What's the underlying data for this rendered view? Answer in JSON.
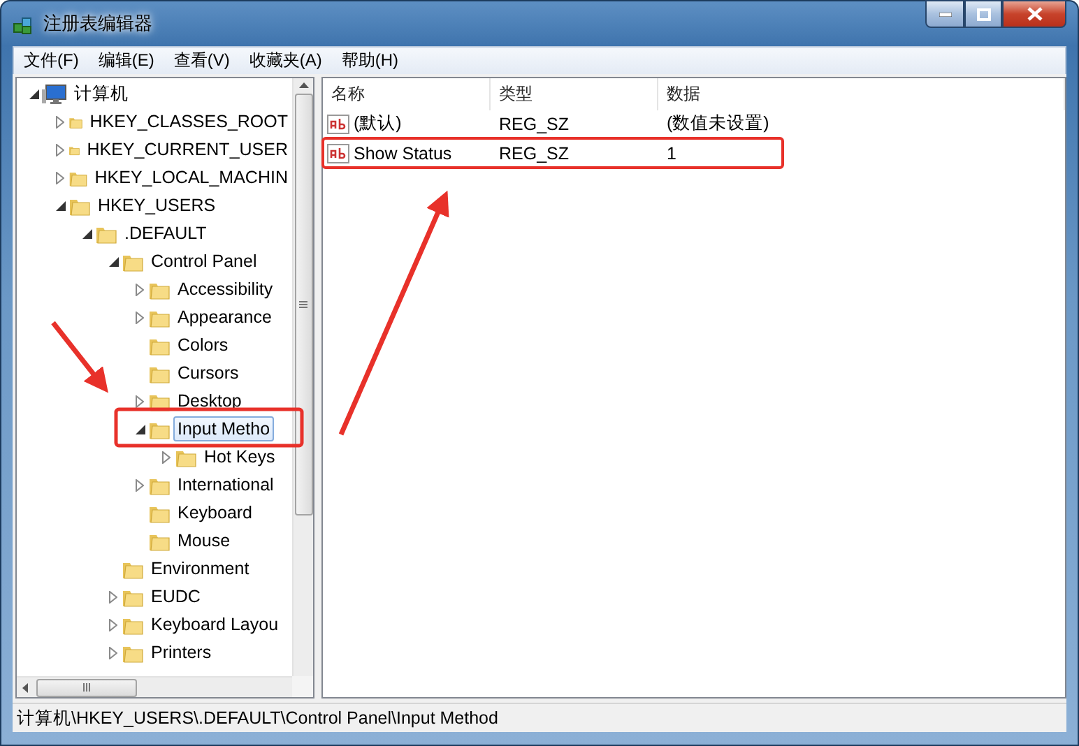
{
  "window": {
    "title": "注册表编辑器"
  },
  "menu": [
    "文件(F)",
    "编辑(E)",
    "查看(V)",
    "收藏夹(A)",
    "帮助(H)"
  ],
  "tree": [
    {
      "label": "计算机",
      "kind": "computer",
      "expandable": true,
      "expanded": true,
      "selected": false,
      "children": [
        {
          "label": "HKEY_CLASSES_ROOT",
          "kind": "folder",
          "expandable": true,
          "expanded": false,
          "selected": false
        },
        {
          "label": "HKEY_CURRENT_USER",
          "kind": "folder",
          "expandable": true,
          "expanded": false,
          "selected": false
        },
        {
          "label": "HKEY_LOCAL_MACHIN",
          "kind": "folder",
          "expandable": true,
          "expanded": false,
          "selected": false
        },
        {
          "label": "HKEY_USERS",
          "kind": "folder",
          "expandable": true,
          "expanded": true,
          "selected": false,
          "children": [
            {
              "label": ".DEFAULT",
              "kind": "folder",
              "expandable": true,
              "expanded": true,
              "selected": false,
              "children": [
                {
                  "label": "Control Panel",
                  "kind": "folder",
                  "expandable": true,
                  "expanded": true,
                  "selected": false,
                  "children": [
                    {
                      "label": "Accessibility",
                      "kind": "folder",
                      "expandable": true,
                      "expanded": false,
                      "selected": false
                    },
                    {
                      "label": "Appearance",
                      "kind": "folder",
                      "expandable": true,
                      "expanded": false,
                      "selected": false
                    },
                    {
                      "label": "Colors",
                      "kind": "folder",
                      "expandable": false,
                      "selected": false
                    },
                    {
                      "label": "Cursors",
                      "kind": "folder",
                      "expandable": false,
                      "selected": false
                    },
                    {
                      "label": "Desktop",
                      "kind": "folder",
                      "expandable": true,
                      "expanded": false,
                      "selected": false
                    },
                    {
                      "label": "Input Metho",
                      "kind": "folder",
                      "expandable": true,
                      "expanded": true,
                      "selected": true,
                      "children": [
                        {
                          "label": "Hot Keys",
                          "kind": "folder",
                          "expandable": true,
                          "expanded": false,
                          "selected": false
                        }
                      ]
                    },
                    {
                      "label": "International",
                      "kind": "folder",
                      "expandable": true,
                      "expanded": false,
                      "selected": false
                    },
                    {
                      "label": "Keyboard",
                      "kind": "folder",
                      "expandable": false,
                      "selected": false
                    },
                    {
                      "label": "Mouse",
                      "kind": "folder",
                      "expandable": false,
                      "selected": false
                    }
                  ]
                },
                {
                  "label": "Environment",
                  "kind": "folder",
                  "expandable": false,
                  "selected": false
                },
                {
                  "label": "EUDC",
                  "kind": "folder",
                  "expandable": true,
                  "expanded": false,
                  "selected": false
                },
                {
                  "label": "Keyboard Layou",
                  "kind": "folder",
                  "expandable": true,
                  "expanded": false,
                  "selected": false
                },
                {
                  "label": "Printers",
                  "kind": "folder",
                  "expandable": true,
                  "expanded": false,
                  "selected": false
                }
              ]
            }
          ]
        }
      ]
    }
  ],
  "table": {
    "columns": [
      "名称",
      "类型",
      "数据"
    ],
    "rows": [
      {
        "cells": [
          "(默认)",
          "REG_SZ",
          "(数值未设置)"
        ],
        "highlighted": false
      },
      {
        "cells": [
          "Show Status",
          "REG_SZ",
          "1"
        ],
        "highlighted": true
      }
    ]
  },
  "status_bar": "计算机\\HKEY_USERS\\.DEFAULT\\Control Panel\\Input Method"
}
